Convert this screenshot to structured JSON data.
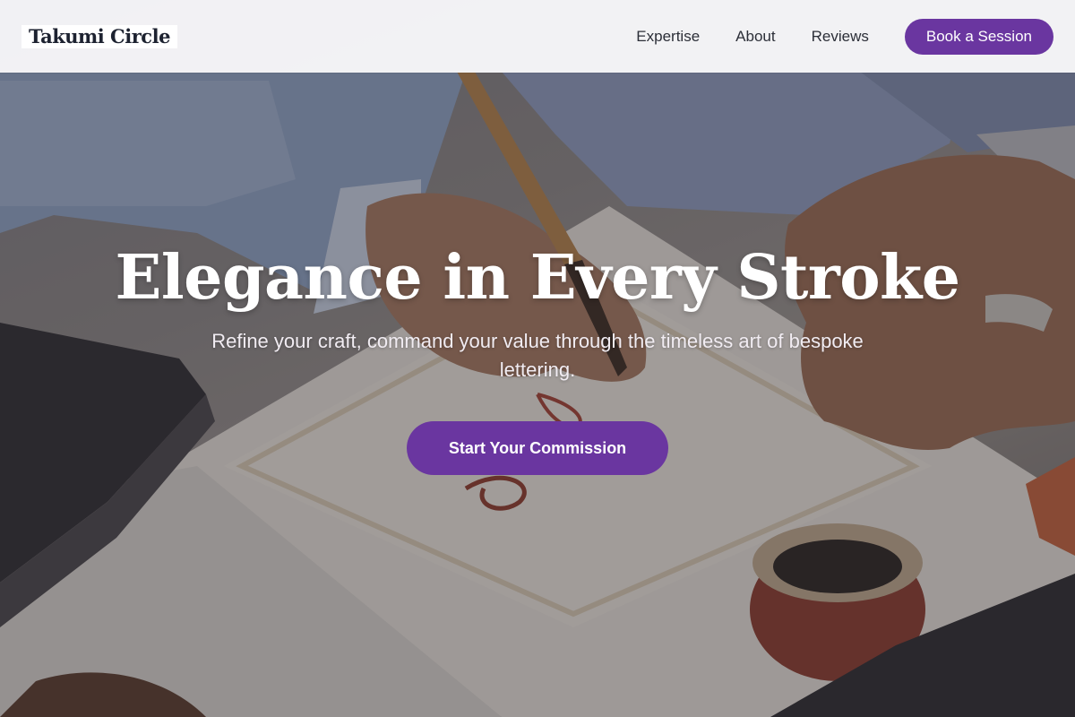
{
  "header": {
    "logo": "Takumi Circle",
    "nav": [
      "Expertise",
      "About",
      "Reviews"
    ],
    "book_label": "Book a Session"
  },
  "hero": {
    "headline": "Elegance in Every Stroke",
    "subhead": "Refine your craft, command your value through the timeless art of bespoke lettering.",
    "cta_label": "Start Your Commission"
  },
  "colors": {
    "accent": "#6a36a0",
    "header_bg": "#f8f8fa",
    "logo_text": "#1d2230"
  }
}
